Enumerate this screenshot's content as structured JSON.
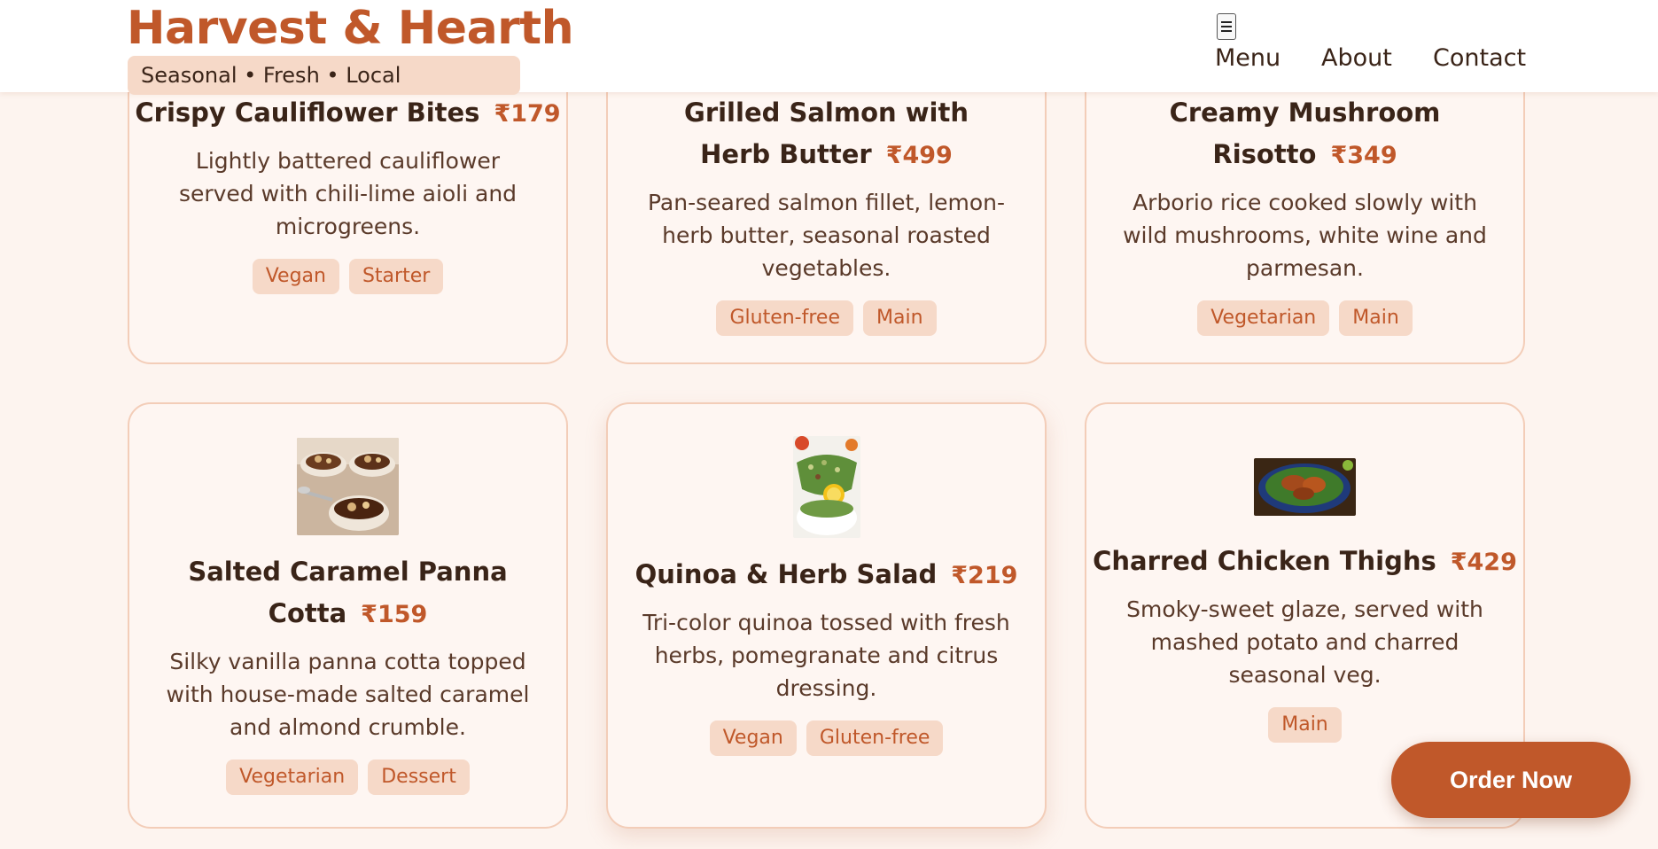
{
  "brand": {
    "title": "Harvest & Hearth",
    "tagline": "Seasonal • Fresh • Local"
  },
  "nav": {
    "toggle_icon": "hamburger-icon",
    "items": [
      "Menu",
      "About",
      "Contact"
    ]
  },
  "menu_items": [
    {
      "name": "Crispy Cauliflower Bites",
      "price": "₹179",
      "description": "Lightly battered cauliflower served with chili-lime aioli and microgreens.",
      "tags": [
        "Vegan",
        "Starter"
      ]
    },
    {
      "name": "Grilled Salmon with Herb Butter",
      "price": "₹499",
      "description": "Pan-seared salmon fillet, lemon-herb butter, seasonal roasted vegetables.",
      "tags": [
        "Gluten-free",
        "Main"
      ]
    },
    {
      "name": "Creamy Mushroom Risotto",
      "price": "₹349",
      "description": "Arborio rice cooked slowly with wild mushrooms, white wine and parmesan.",
      "tags": [
        "Vegetarian",
        "Main"
      ]
    },
    {
      "name": "Salted Caramel Panna Cotta",
      "price": "₹159",
      "description": "Silky vanilla panna cotta topped with house-made salted caramel and almond crumble.",
      "tags": [
        "Vegetarian",
        "Dessert"
      ],
      "image": "panna-cotta-photo"
    },
    {
      "name": "Quinoa & Herb Salad",
      "price": "₹219",
      "description": "Tri-color quinoa tossed with fresh herbs, pomegranate and citrus dressing.",
      "tags": [
        "Vegan",
        "Gluten-free"
      ],
      "image": "quinoa-salad-photo"
    },
    {
      "name": "Charred Chicken Thighs",
      "price": "₹429",
      "description": "Smoky-sweet glaze, served with mashed potato and charred seasonal veg.",
      "tags": [
        "Main"
      ],
      "image": "chicken-thighs-photo"
    }
  ],
  "cta": {
    "label": "Order Now"
  },
  "colors": {
    "accent": "#c0582a",
    "tag_bg": "#f6d9c8",
    "page_bg": "#fdf4ef",
    "card_border": "#f3cdb8"
  }
}
